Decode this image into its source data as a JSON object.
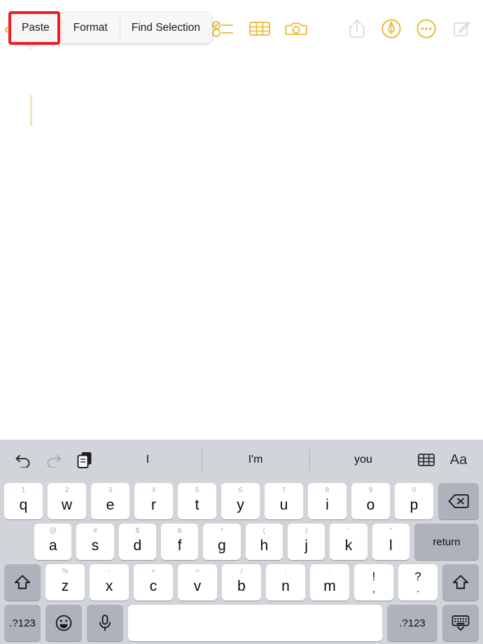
{
  "toolbar": {
    "icons": [
      {
        "name": "checklist-icon",
        "label": "Checklist",
        "color": "#e8b82e"
      },
      {
        "name": "table-icon",
        "label": "Table",
        "color": "#e8b82e"
      },
      {
        "name": "camera-icon",
        "label": "Camera",
        "color": "#e8b82e"
      },
      {
        "name": "share-icon",
        "label": "Share",
        "color": "#d9d9d9"
      },
      {
        "name": "markup-icon",
        "label": "Markup",
        "color": "#e8b82e"
      },
      {
        "name": "more-icon",
        "label": "More",
        "color": "#e8b82e"
      },
      {
        "name": "compose-icon",
        "label": "Compose",
        "color": "#d9d9d9"
      }
    ],
    "chevron_right": "›",
    "chevron_left": "‹"
  },
  "context_menu": {
    "items": [
      {
        "label": "Paste",
        "highlighted": true
      },
      {
        "label": "Format",
        "highlighted": false
      },
      {
        "label": "Find Selection",
        "highlighted": false
      }
    ],
    "highlight_color": "#ee1c25"
  },
  "note": {
    "body_text": "",
    "cursor_color": "#efe2bd"
  },
  "keyboard": {
    "predictions": [
      "I",
      "I'm",
      "you"
    ],
    "left_icons": [
      {
        "name": "undo-icon",
        "label": "Undo",
        "enabled": true
      },
      {
        "name": "redo-icon",
        "label": "Redo",
        "enabled": false
      },
      {
        "name": "paste-icon",
        "label": "Paste",
        "enabled": true
      }
    ],
    "right_icons": [
      {
        "name": "table-icon",
        "label": "Table"
      },
      {
        "name": "format-text-icon",
        "label": "Aa"
      }
    ],
    "row1": [
      {
        "sub": "1",
        "main": "q"
      },
      {
        "sub": "2",
        "main": "w"
      },
      {
        "sub": "3",
        "main": "e"
      },
      {
        "sub": "4",
        "main": "r"
      },
      {
        "sub": "5",
        "main": "t"
      },
      {
        "sub": "6",
        "main": "y"
      },
      {
        "sub": "7",
        "main": "u"
      },
      {
        "sub": "8",
        "main": "i"
      },
      {
        "sub": "9",
        "main": "o"
      },
      {
        "sub": "0",
        "main": "p"
      }
    ],
    "backspace_label": "⌫",
    "row2": [
      {
        "sub": "@",
        "main": "a"
      },
      {
        "sub": "#",
        "main": "s"
      },
      {
        "sub": "$",
        "main": "d"
      },
      {
        "sub": "&",
        "main": "f"
      },
      {
        "sub": "*",
        "main": "g"
      },
      {
        "sub": "(",
        "main": "h"
      },
      {
        "sub": ")",
        "main": "j"
      },
      {
        "sub": "‘",
        "main": "k"
      },
      {
        "sub": "“",
        "main": "l"
      }
    ],
    "return_label": "return",
    "row3": [
      {
        "sub": "%",
        "main": "z"
      },
      {
        "sub": "-",
        "main": "x"
      },
      {
        "sub": "+",
        "main": "c"
      },
      {
        "sub": "=",
        "main": "v"
      },
      {
        "sub": "/",
        "main": "b"
      },
      {
        "sub": ";",
        "main": "n"
      },
      {
        "sub": ":",
        "main": "m"
      }
    ],
    "punct_keys": [
      {
        "top": "!",
        "bottom": ","
      },
      {
        "top": "?",
        "bottom": "."
      }
    ],
    "shift_label": "⇧",
    "row4": {
      "numbers_left": ".?123",
      "emoji_label": "☺",
      "mic_label": "mic",
      "space_label": "",
      "numbers_right": ".?123",
      "dismiss_label": "dismiss"
    }
  }
}
